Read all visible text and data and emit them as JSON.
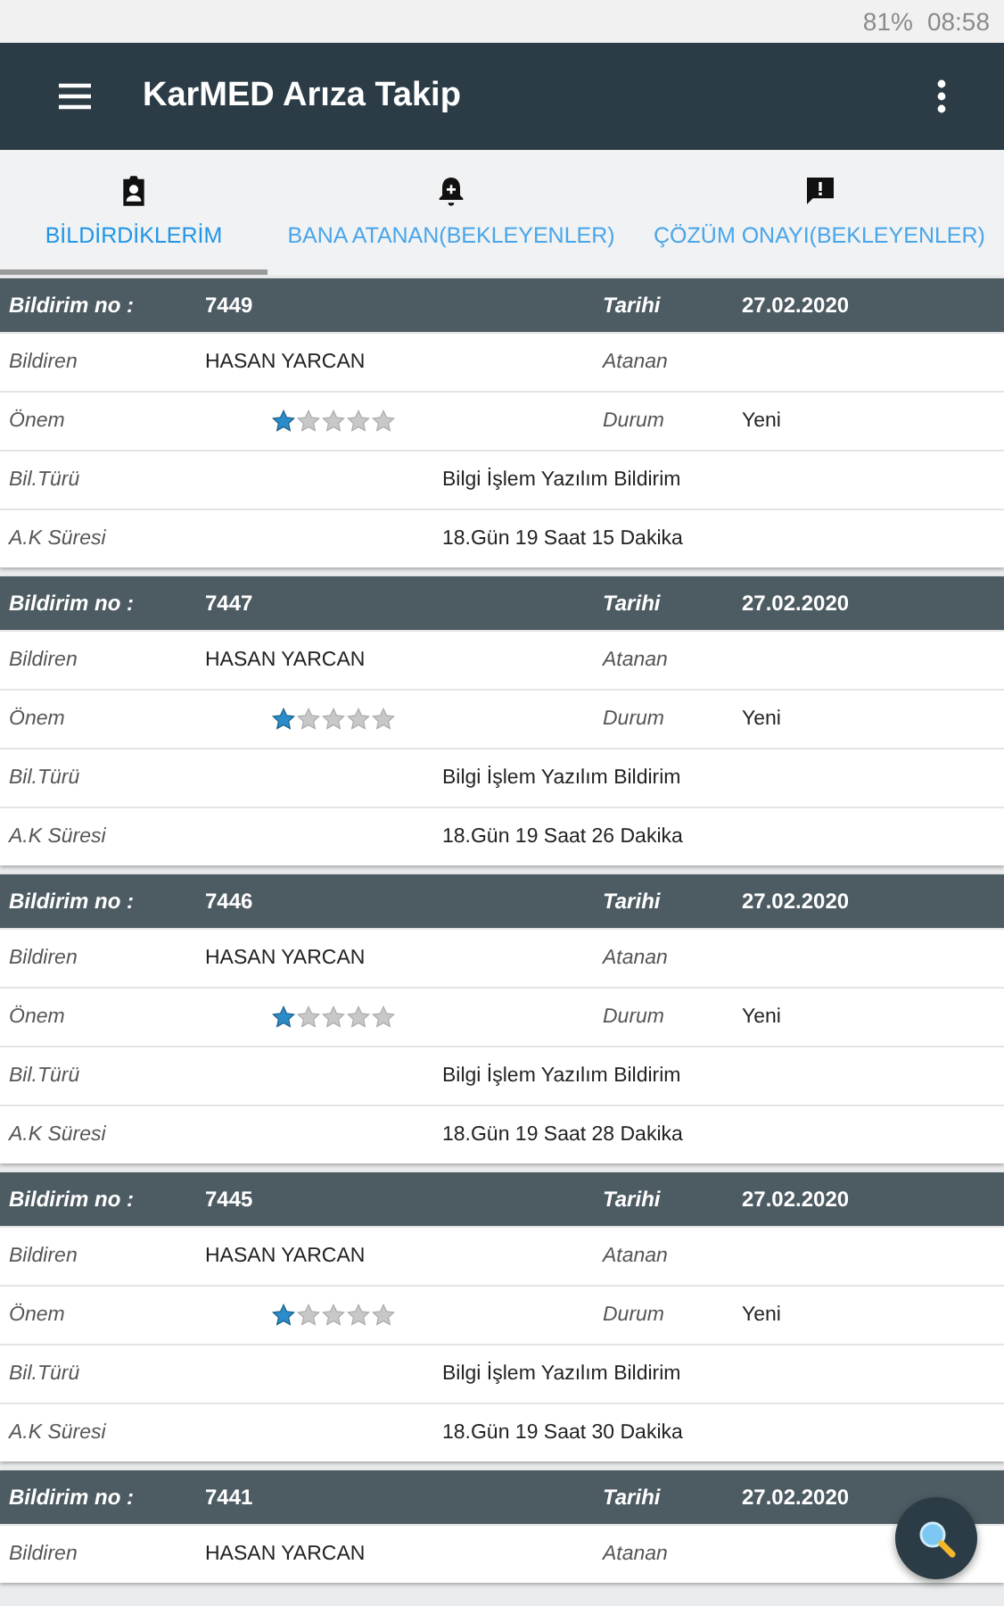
{
  "status_bar": {
    "battery": "81%",
    "time": "08:58"
  },
  "app_bar": {
    "title": "KarMED Arıza Takip"
  },
  "tabs": [
    {
      "label": "BİLDİRDİKLERİM",
      "selected": true
    },
    {
      "label": "BANA ATANAN(BEKLEYENLER)",
      "selected": false
    },
    {
      "label": "ÇÖZÜM ONAYI(BEKLEYENLER)",
      "selected": false
    }
  ],
  "cards": [
    {
      "header": {
        "label": "Bildirim no :",
        "number": "7449",
        "date_label": "Tarihi",
        "date": "27.02.2020"
      },
      "rows": [
        {
          "kind": "pair",
          "label": "Bildiren",
          "value": "HASAN YARCAN",
          "label2": "Atanan"
        },
        {
          "kind": "stars",
          "label": "Önem",
          "stars": 1,
          "label2": "Durum",
          "value2": "Yeni"
        },
        {
          "kind": "wide",
          "label": "Bil.Türü",
          "value": "Bilgi İşlem Yazılım Bildirim"
        },
        {
          "kind": "wide",
          "label": "A.K Süresi",
          "value": "18.Gün 19 Saat 15 Dakika"
        }
      ]
    },
    {
      "header": {
        "label": "Bildirim no :",
        "number": "7447",
        "date_label": "Tarihi",
        "date": "27.02.2020"
      },
      "rows": [
        {
          "kind": "pair",
          "label": "Bildiren",
          "value": "HASAN YARCAN",
          "label2": "Atanan"
        },
        {
          "kind": "stars",
          "label": "Önem",
          "stars": 1,
          "label2": "Durum",
          "value2": "Yeni"
        },
        {
          "kind": "wide",
          "label": "Bil.Türü",
          "value": "Bilgi İşlem Yazılım Bildirim"
        },
        {
          "kind": "wide",
          "label": "A.K Süresi",
          "value": "18.Gün 19 Saat 26 Dakika"
        }
      ]
    },
    {
      "header": {
        "label": "Bildirim no :",
        "number": "7446",
        "date_label": "Tarihi",
        "date": "27.02.2020"
      },
      "rows": [
        {
          "kind": "pair",
          "label": "Bildiren",
          "value": "HASAN YARCAN",
          "label2": "Atanan"
        },
        {
          "kind": "stars",
          "label": "Önem",
          "stars": 1,
          "label2": "Durum",
          "value2": "Yeni"
        },
        {
          "kind": "wide",
          "label": "Bil.Türü",
          "value": "Bilgi İşlem Yazılım Bildirim"
        },
        {
          "kind": "wide",
          "label": "A.K Süresi",
          "value": "18.Gün 19 Saat 28 Dakika"
        }
      ]
    },
    {
      "header": {
        "label": "Bildirim no :",
        "number": "7445",
        "date_label": "Tarihi",
        "date": "27.02.2020"
      },
      "rows": [
        {
          "kind": "pair",
          "label": "Bildiren",
          "value": "HASAN YARCAN",
          "label2": "Atanan"
        },
        {
          "kind": "stars",
          "label": "Önem",
          "stars": 1,
          "label2": "Durum",
          "value2": "Yeni"
        },
        {
          "kind": "wide",
          "label": "Bil.Türü",
          "value": "Bilgi İşlem Yazılım Bildirim"
        },
        {
          "kind": "wide",
          "label": "A.K Süresi",
          "value": "18.Gün 19 Saat 30 Dakika"
        }
      ]
    },
    {
      "header": {
        "label": "Bildirim no :",
        "number": "7441",
        "date_label": "Tarihi",
        "date": "27.02.2020"
      },
      "rows": [
        {
          "kind": "pair",
          "label": "Bildiren",
          "value": "HASAN YARCAN",
          "label2": "Atanan"
        }
      ]
    }
  ]
}
